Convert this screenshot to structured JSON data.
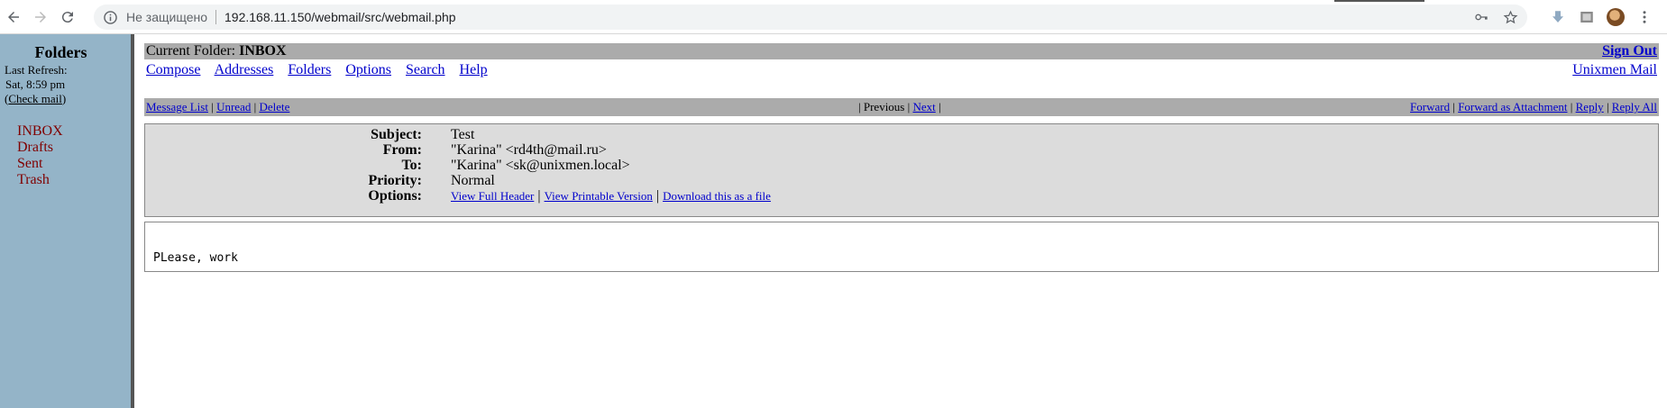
{
  "browser": {
    "security_label": "Не защищено",
    "url": "192.168.11.150/webmail/src/webmail.php"
  },
  "sidebar": {
    "title": "Folders",
    "last_refresh_label": "Last Refresh:",
    "last_refresh_value": "Sat, 8:59 pm",
    "check_mail": "Check mail",
    "folders": [
      {
        "label": "INBOX"
      },
      {
        "label": "Drafts"
      },
      {
        "label": "Sent"
      },
      {
        "label": "Trash"
      }
    ]
  },
  "header": {
    "current_folder_label": "Current Folder:",
    "current_folder": "INBOX",
    "sign_out": "Sign Out",
    "brand": "Unixmen Mail",
    "menu": [
      "Compose",
      "Addresses",
      "Folders",
      "Options",
      "Search",
      "Help"
    ]
  },
  "actions": {
    "left": [
      "Message List",
      "Unread",
      "Delete"
    ],
    "previous": "Previous",
    "next": "Next",
    "right": [
      "Forward",
      "Forward as Attachment",
      "Reply",
      "Reply All"
    ]
  },
  "message": {
    "subject_label": "Subject:",
    "subject": "Test",
    "from_label": "From:",
    "from": "\"Karina\" <rd4th@mail.ru>",
    "to_label": "To:",
    "to": "\"Karina\" <sk@unixmen.local>",
    "priority_label": "Priority:",
    "priority": "Normal",
    "options_label": "Options:",
    "options": [
      "View Full Header",
      "View Printable Version",
      "Download this as a file"
    ],
    "body": "PLease, work"
  }
}
